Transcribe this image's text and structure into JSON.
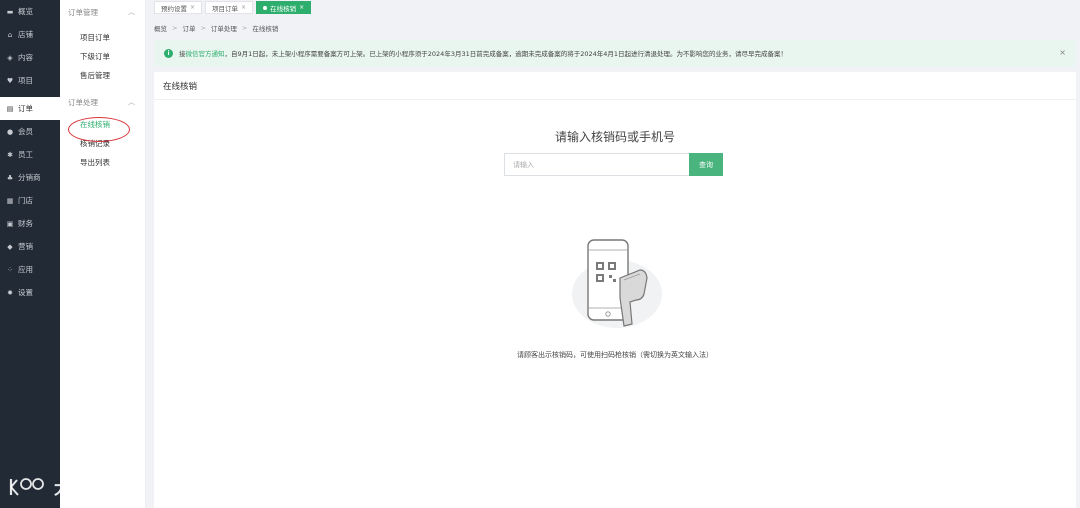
{
  "nav": [
    {
      "label": "概览",
      "icon": "monitor-icon",
      "glyph": "▬"
    },
    {
      "label": "店铺",
      "icon": "home-icon",
      "glyph": "⌂"
    },
    {
      "label": "内容",
      "icon": "layers-icon",
      "glyph": "◈"
    },
    {
      "label": "项目",
      "icon": "heart-icon",
      "glyph": "♥"
    },
    {
      "label": "订单",
      "icon": "document-icon",
      "glyph": "▤",
      "active": true
    },
    {
      "label": "会员",
      "icon": "user-icon",
      "glyph": "●"
    },
    {
      "label": "员工",
      "icon": "gear-badge-icon",
      "glyph": "✱"
    },
    {
      "label": "分销商",
      "icon": "org-tree-icon",
      "glyph": "♣"
    },
    {
      "label": "门店",
      "icon": "store-icon",
      "glyph": "▦"
    },
    {
      "label": "财务",
      "icon": "wallet-icon",
      "glyph": "▣"
    },
    {
      "label": "营销",
      "icon": "tag-icon",
      "glyph": "◆"
    },
    {
      "label": "应用",
      "icon": "apps-grid-icon",
      "glyph": "⁘"
    },
    {
      "label": "设置",
      "icon": "settings-icon",
      "glyph": "✹"
    }
  ],
  "submenu": {
    "group1": {
      "title": "订单管理",
      "items": [
        "项目订单",
        "下级订单",
        "售后管理"
      ]
    },
    "group2": {
      "title": "订单处理",
      "items": [
        "在线核销",
        "核销记录",
        "导出列表"
      ]
    }
  },
  "tabs": [
    {
      "label": "预约设置"
    },
    {
      "label": "项目订单"
    },
    {
      "label": "在线核销",
      "active": true
    }
  ],
  "breadcrumb": [
    "概览",
    "订单",
    "订单处理",
    "在线核销"
  ],
  "notice": {
    "prefix": "接",
    "link": "微信官方通知",
    "text": "，自9月1日起，未上架小程序需要备案方可上架。已上架的小程序须于2024年3月31日前完成备案，逾期未完成备案的将于2024年4月1日起进行清退处理。为不影响您的业务，请尽早完成备案！"
  },
  "card": {
    "title": "在线核销",
    "prompt": "请输入核销码或手机号",
    "input_placeholder": "请输入",
    "query_label": "查询",
    "hint": "请顾客出示核销码，可使用扫码枪核销（需切换为英文输入法）"
  },
  "watermark": "大数跨境",
  "colors": {
    "accent": "#2dae6d",
    "nav_bg": "#222a36",
    "highlight": "#d9343a"
  }
}
